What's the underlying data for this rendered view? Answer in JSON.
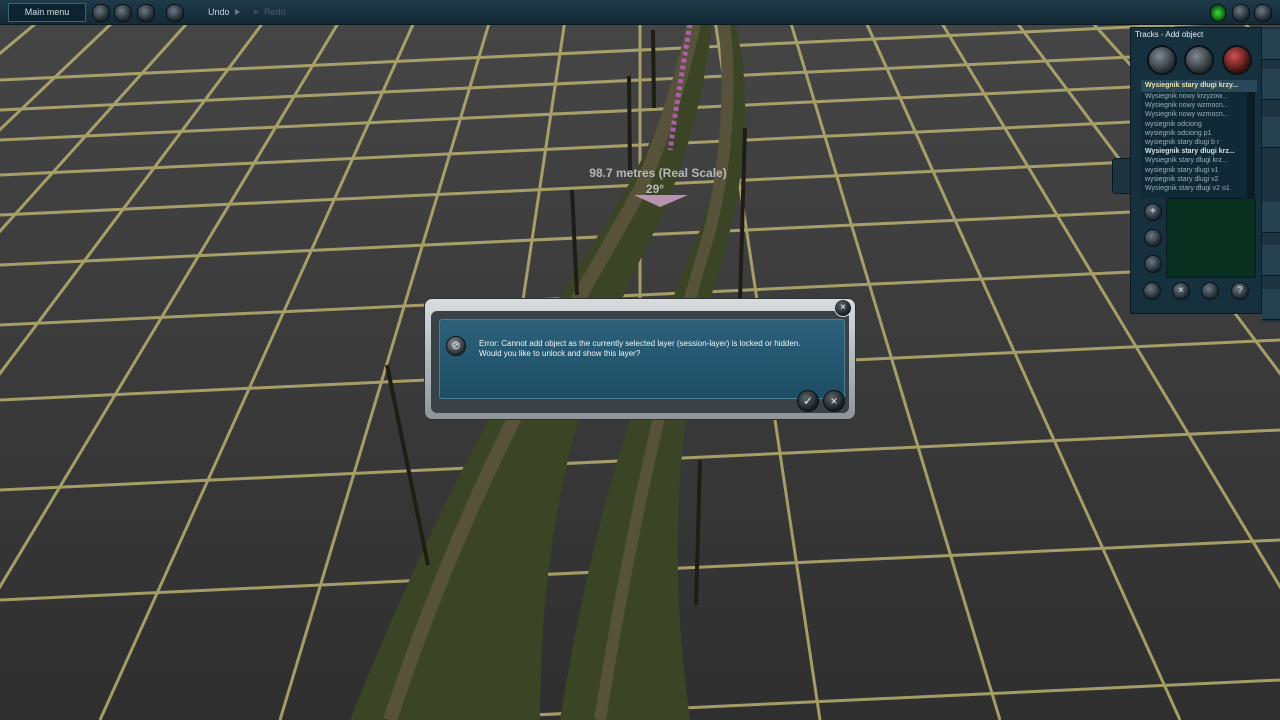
{
  "toolbar": {
    "main_menu_label": "Main menu",
    "undo_label": "Undo",
    "redo_label": "Redo"
  },
  "viewport": {
    "measurement": "98.7 metres (Real Scale)",
    "angle": "29°"
  },
  "side_panel": {
    "title": "Tracks - Add object",
    "selected_object": "Wysiegnik stary dlugi krzy...",
    "objects": [
      "Wysiegnik nowy krzyzow...",
      "Wysiegnik nowy wzmocn...",
      "Wysiegnik nowy wzmocn...",
      "wysiegnik odciong",
      "wysiegnik odciong p1",
      "wysiegnik stary dlugi b r",
      "Wysiegnik stary dlugi krz...",
      "Wysiegnik stary dlugi krz...",
      "wysiegnik stary dlugi v1",
      "wysiegnik stary dlugi v2",
      "Wysiegnik stary dlugi v2 o1"
    ],
    "highlighted_index": 6
  },
  "dialog": {
    "message_line1": "Error: Cannot add object as the currently selected layer (session-layer) is locked or hidden.",
    "message_line2": "Would you like to unlock and show this layer?"
  },
  "colors": {
    "grid_line": "#b8b070",
    "ground": "#3b3b3b",
    "panel_bg": "#16303d",
    "dialog_body": "#245872"
  }
}
